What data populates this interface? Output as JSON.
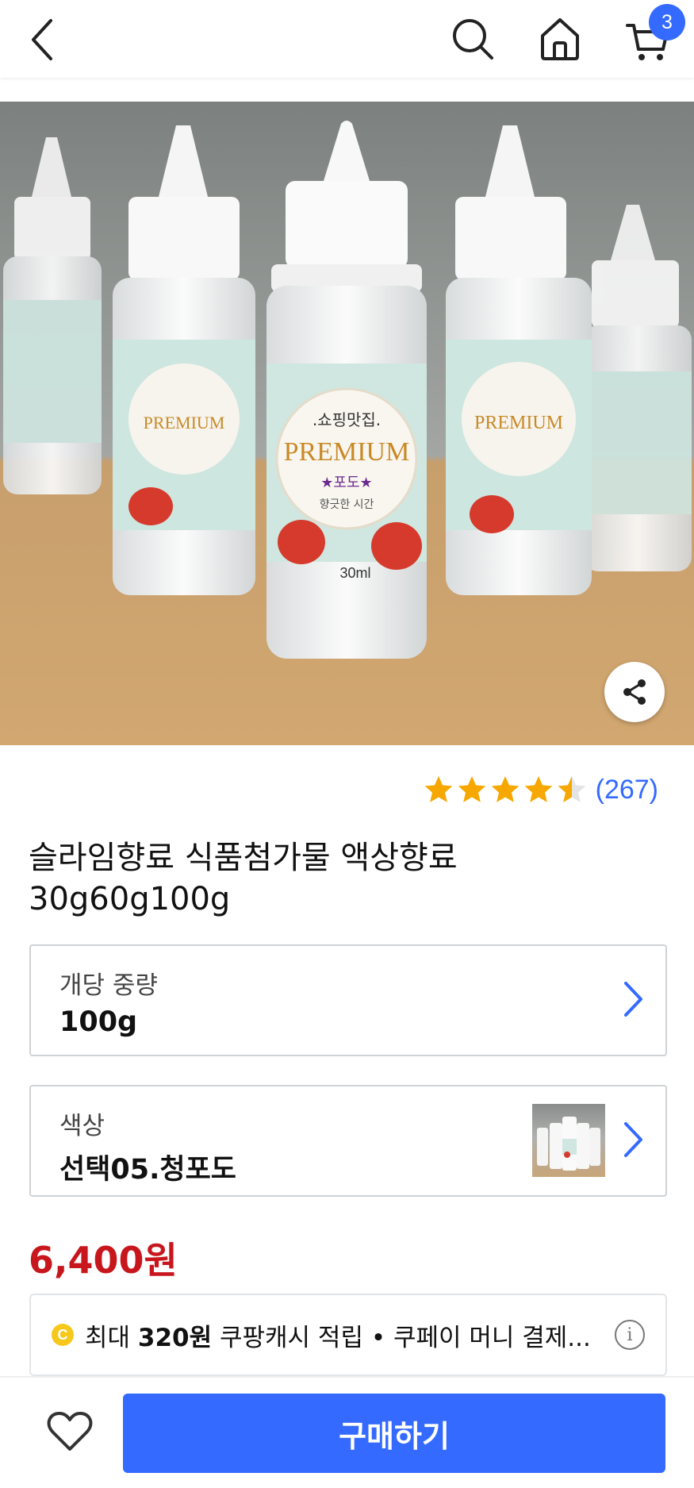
{
  "header": {
    "back_icon": "chevron-left-icon",
    "search_icon": "search-icon",
    "home_icon": "home-icon",
    "cart_icon": "cart-icon",
    "cart_count": "3"
  },
  "product": {
    "image_alt": "bottles photo",
    "rating": 4.5,
    "review_count": "(267)",
    "title_line1": "슬라임향료 식품첨가물 액상향료",
    "title_line2": "30g60g100g",
    "bottle_label": {
      "brand": ".쇼핑맛집.",
      "name": "PREMIUM",
      "flavor": "★포도★",
      "slogan": "향긋한 시간",
      "volume": "30ml"
    }
  },
  "options": [
    {
      "label": "개당 중량",
      "value": "100g"
    },
    {
      "label": "색상",
      "value": "선택05.청포도"
    }
  ],
  "price": "6,400원",
  "benefit": {
    "coin_icon": "C",
    "prefix": "최대 ",
    "amount": "320원",
    "suffix": " 쿠팡캐시 적립 • 쿠페이 머니 결제...",
    "info_icon": "i"
  },
  "bottom": {
    "wishlist_icon": "heart-icon",
    "buy_label": "구매하기"
  },
  "colors": {
    "accent": "#346aff",
    "price": "#c8161d",
    "star": "#f6a800"
  }
}
